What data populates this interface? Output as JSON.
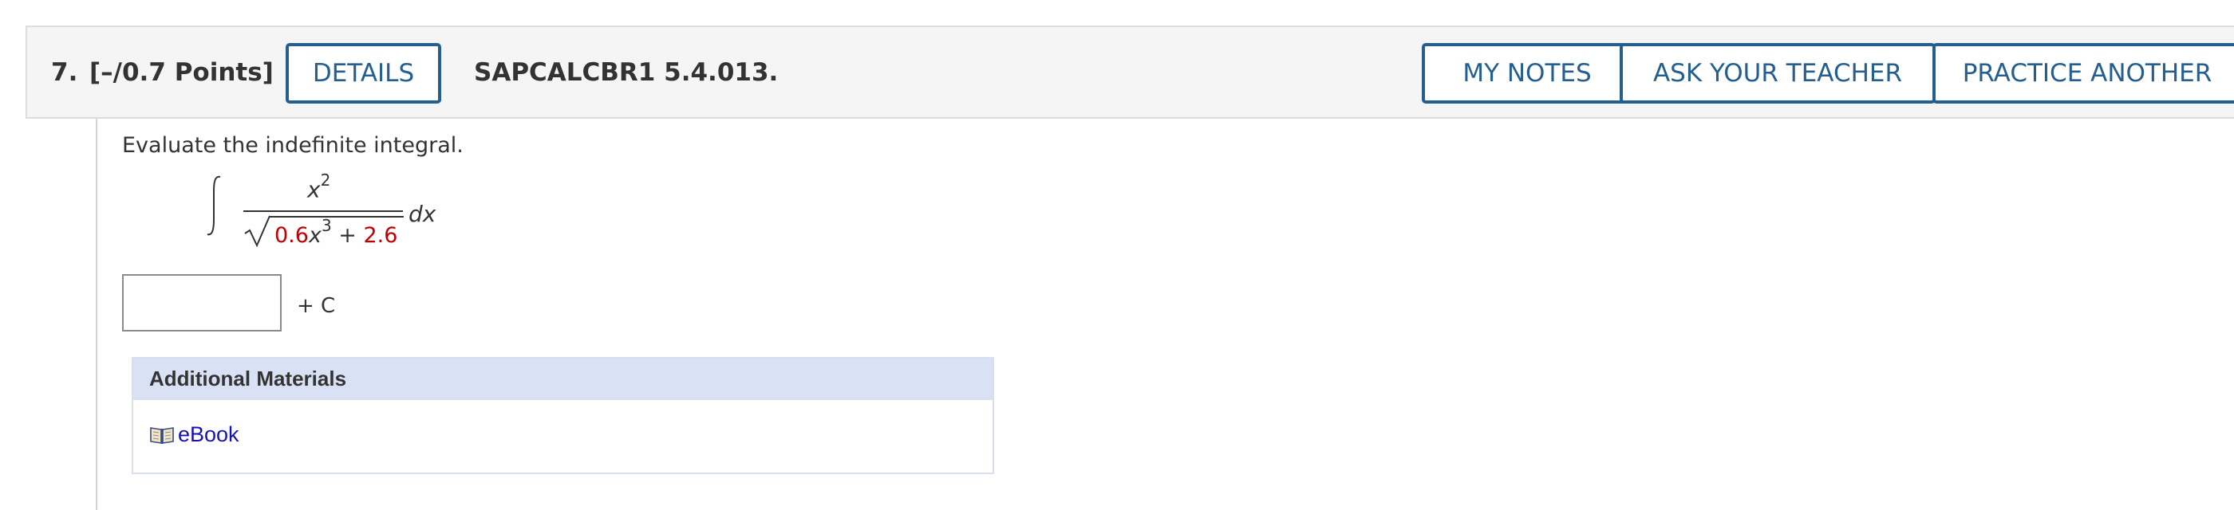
{
  "question": {
    "number": "7.",
    "points": "[–/0.7 Points]",
    "code": "SAPCALCBR1 5.4.013."
  },
  "header_buttons": {
    "details": "DETAILS",
    "my_notes": "MY NOTES",
    "ask_teacher": "ASK YOUR TEACHER",
    "practice_another": "PRACTICE ANOTHER"
  },
  "prompt": "Evaluate the indefinite integral.",
  "integral": {
    "sign": "∫",
    "numerator_base": "x",
    "numerator_exp": "2",
    "radical_sign": "√",
    "coef": "0.6",
    "den_var": "x",
    "den_exp": "3",
    "den_plus": " + ",
    "constant": "2.6",
    "differential": "dx"
  },
  "answer": {
    "value": "",
    "suffix": "+ C"
  },
  "materials": {
    "heading": "Additional Materials",
    "icon": "book-icon",
    "link_label": "eBook"
  },
  "colors": {
    "button_border": "#245f8f",
    "header_bg": "#f5f5f5",
    "materials_head_bg": "#d9e2f4",
    "randomized_value": "#c00000",
    "link": "#1a12b0"
  }
}
